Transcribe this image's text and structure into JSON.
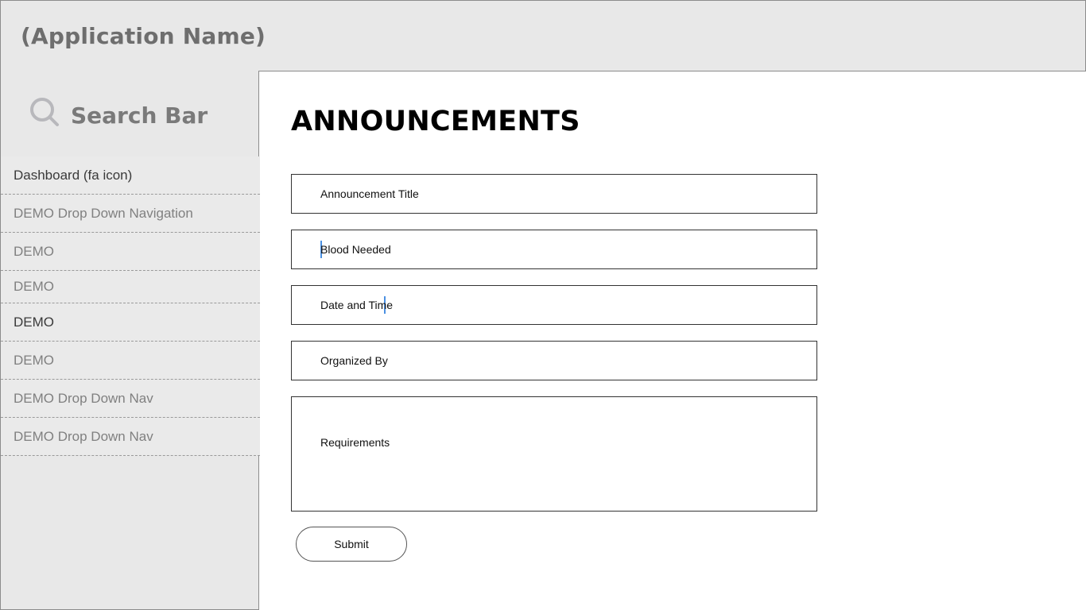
{
  "header": {
    "app_name": "(Application Name)"
  },
  "sidebar": {
    "search": {
      "icon": "search-icon",
      "label": "Search Bar"
    },
    "items": [
      {
        "label": "Dashboard (fa icon)"
      },
      {
        "label": "DEMO Drop Down Navigation"
      },
      {
        "label": "DEMO"
      },
      {
        "label": "DEMO"
      },
      {
        "label": "DEMO"
      },
      {
        "label": "DEMO"
      },
      {
        "label": "DEMO Drop Down Nav"
      },
      {
        "label": "DEMO Drop Down Nav"
      }
    ]
  },
  "main": {
    "title": "ANNOUNCEMENTS",
    "fields": {
      "announcement_title": "Announcement Title",
      "blood_needed": "Blood Needed",
      "date_time": "Date and Time",
      "organized_by": "Organized By",
      "requirements": "Requirements"
    },
    "submit_label": "Submit"
  },
  "colors": {
    "header_bg": "#e8e8e8",
    "sidebar_bg": "#e8e8e8",
    "caret": "#4a90e2"
  }
}
